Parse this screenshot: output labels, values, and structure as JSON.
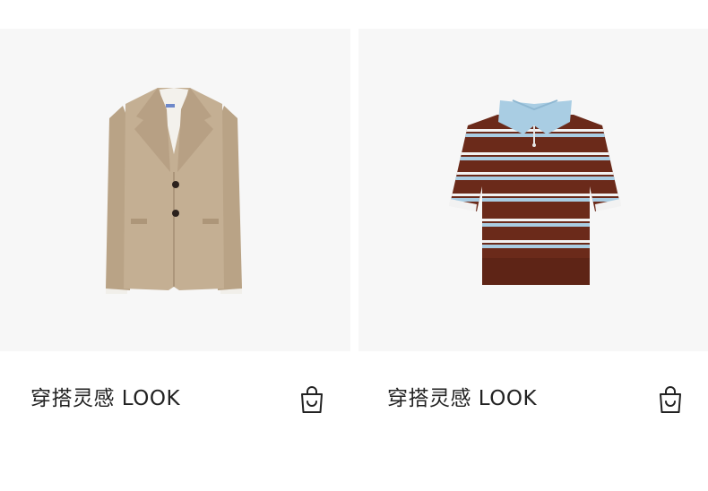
{
  "products": [
    {
      "caption": "穿搭灵感 LOOK",
      "image_icon": "beige-blazer-image",
      "cart_icon": "shopping-bag-icon"
    },
    {
      "caption": "穿搭灵感 LOOK",
      "image_icon": "striped-polo-image",
      "cart_icon": "shopping-bag-icon"
    }
  ],
  "colors": {
    "image_background": "#f7f7f7",
    "text": "#222222",
    "blazer": "#c2ad92",
    "polo_brown": "#6b2a1a",
    "polo_blue": "#a9cde3"
  }
}
